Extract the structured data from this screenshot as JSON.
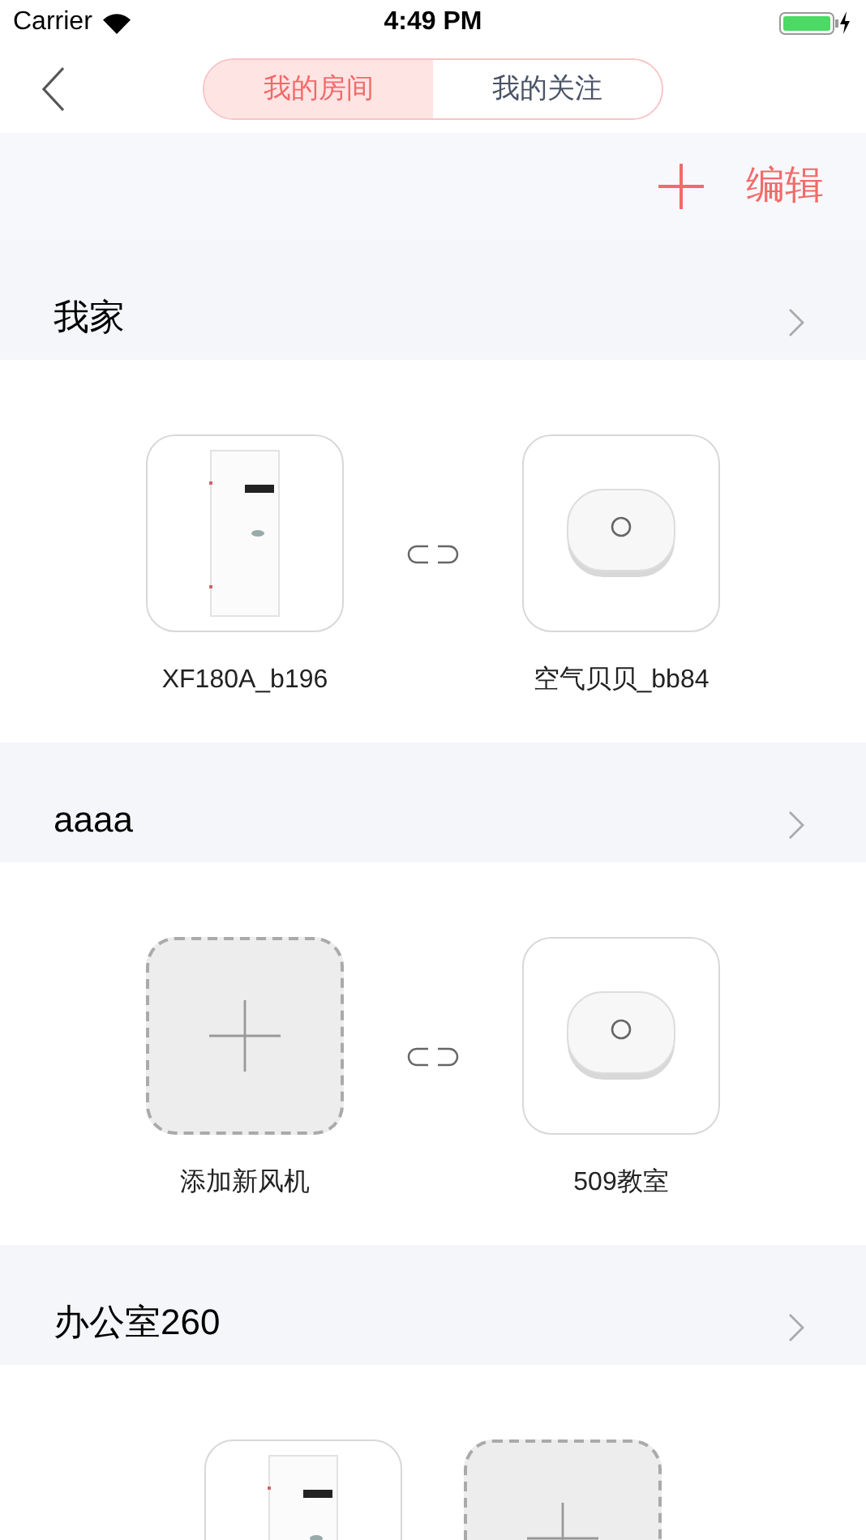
{
  "status_bar": {
    "carrier": "Carrier",
    "time": "4:49 PM"
  },
  "tabs": [
    {
      "label": "我的房间",
      "selected": true
    },
    {
      "label": "我的关注",
      "selected": false
    }
  ],
  "toolbar": {
    "edit": "编辑"
  },
  "rooms": [
    {
      "name": "我家",
      "devices": [
        {
          "kind": "ventilator",
          "label": "XF180A_b196"
        },
        {
          "kind": "sensor",
          "label": "空气贝贝_bb84"
        }
      ]
    },
    {
      "name": "aaaa",
      "devices": [
        {
          "kind": "add",
          "label": "添加新风机"
        },
        {
          "kind": "sensor",
          "label": "509教室"
        }
      ]
    },
    {
      "name": "办公室260",
      "devices": [
        {
          "kind": "ventilator"
        },
        {
          "kind": "add"
        }
      ]
    }
  ]
}
